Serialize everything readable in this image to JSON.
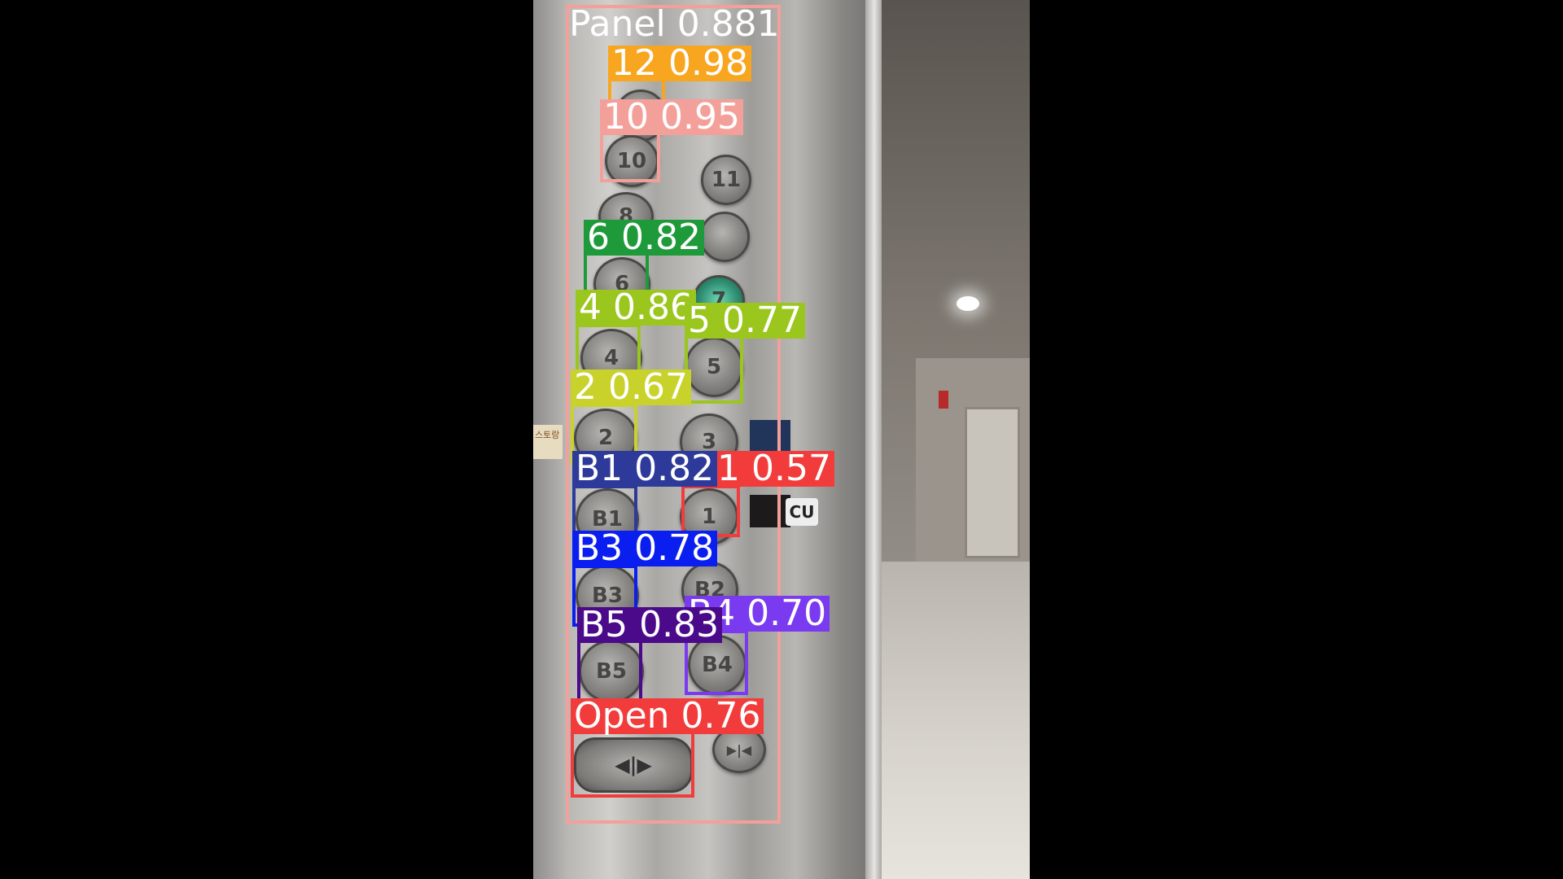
{
  "scene": {
    "buttons": [
      {
        "name": "button-12",
        "text": ""
      },
      {
        "name": "button-10",
        "text": "10"
      },
      {
        "name": "button-11",
        "text": "11"
      },
      {
        "name": "button-8",
        "text": "8"
      },
      {
        "name": "button-9",
        "text": ""
      },
      {
        "name": "button-6",
        "text": "6"
      },
      {
        "name": "button-7",
        "text": "7"
      },
      {
        "name": "button-4",
        "text": "4"
      },
      {
        "name": "button-5",
        "text": "5"
      },
      {
        "name": "button-2",
        "text": "2"
      },
      {
        "name": "button-3",
        "text": "3"
      },
      {
        "name": "button-b1",
        "text": "B1"
      },
      {
        "name": "button-1",
        "text": "1"
      },
      {
        "name": "button-b3",
        "text": "B3"
      },
      {
        "name": "button-b2",
        "text": "B2"
      },
      {
        "name": "button-b5",
        "text": "B5"
      },
      {
        "name": "button-b4",
        "text": "B4"
      },
      {
        "name": "button-open",
        "text": "◀|▶"
      },
      {
        "name": "button-close",
        "text": "▶|◀"
      }
    ],
    "sticker_text": "스토랑",
    "cu_text": "CU"
  },
  "detections": [
    {
      "label": "Panel 0.881",
      "color": "#f4a09a"
    },
    {
      "label": "12 0.98",
      "color": "#f8a620"
    },
    {
      "label": "10 0.95",
      "color": "#f4a09a"
    },
    {
      "label": "6 0.82",
      "color": "#1f9a3a"
    },
    {
      "label": "4 0.86",
      "color": "#9bc61e"
    },
    {
      "label": "5 0.77",
      "color": "#9bc61e"
    },
    {
      "label": "2 0.67",
      "color": "#c8d22a"
    },
    {
      "label": "1 0.57",
      "color": "#f23c3c"
    },
    {
      "label": "B1 0.82",
      "color": "#2e3a9a"
    },
    {
      "label": "B3 0.78",
      "color": "#0a1ef0"
    },
    {
      "label": "B4 0.70",
      "color": "#7a3af0"
    },
    {
      "label": "B5 0.83",
      "color": "#4a0a8a"
    },
    {
      "label": "Open 0.76",
      "color": "#f23c3c"
    }
  ]
}
